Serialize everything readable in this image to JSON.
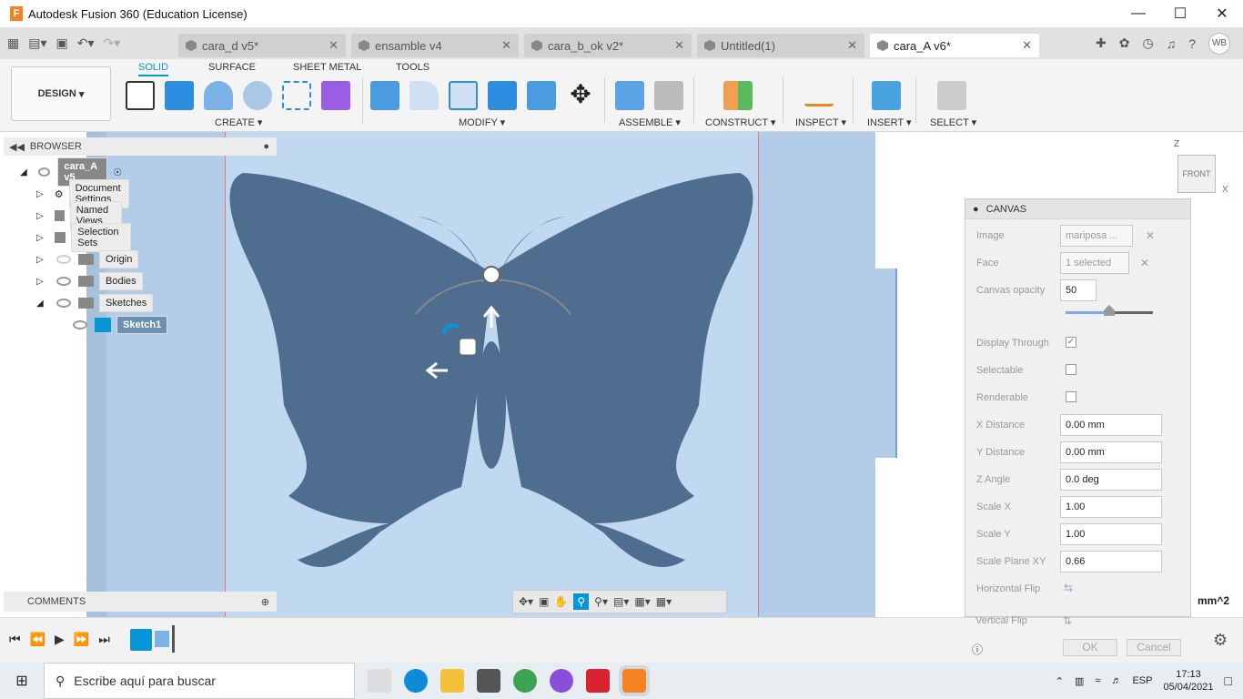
{
  "window": {
    "title": "Autodesk Fusion 360 (Education License)",
    "logo_letter": "F"
  },
  "tabs": [
    {
      "label": "cara_d v5*"
    },
    {
      "label": "ensamble v4"
    },
    {
      "label": "cara_b_ok v2*"
    },
    {
      "label": "Untitled(1)"
    },
    {
      "label": "cara_A v6*"
    }
  ],
  "user": {
    "initials": "WB"
  },
  "toolbar": {
    "design_label": "DESIGN",
    "workspace_tabs": [
      "SOLID",
      "SURFACE",
      "SHEET METAL",
      "TOOLS"
    ],
    "groups": [
      "CREATE",
      "MODIFY",
      "ASSEMBLE",
      "CONSTRUCT",
      "INSPECT",
      "INSERT",
      "SELECT"
    ]
  },
  "browser": {
    "title": "BROWSER",
    "root": "cara_A v5",
    "items": [
      "Document Settings",
      "Named Views",
      "Selection Sets",
      "Origin",
      "Bodies",
      "Sketches",
      "Sketch1"
    ]
  },
  "comments": {
    "title": "COMMENTS"
  },
  "viewcube": {
    "label": "FRONT",
    "z": "Z",
    "x": "X"
  },
  "area_readout": "mm^2",
  "canvas_panel": {
    "title": "CANVAS",
    "image_label": "Image",
    "image_value": "mariposa ...",
    "face_label": "Face",
    "face_value": "1 selected",
    "opacity_label": "Canvas opacity",
    "opacity_value": "50",
    "opacity_level": 0.5,
    "display_through": "Display Through",
    "selectable": "Selectable",
    "renderable": "Renderable",
    "x_distance_label": "X Distance",
    "x_distance": "0.00 mm",
    "y_distance_label": "Y Distance",
    "y_distance": "0.00 mm",
    "z_angle_label": "Z Angle",
    "z_angle": "0.0 deg",
    "scale_x_label": "Scale X",
    "scale_x": "1.00",
    "scale_y_label": "Scale Y",
    "scale_y": "1.00",
    "scale_plane_label": "Scale Plane XY",
    "scale_plane": "0.66",
    "hflip": "Horizontal Flip",
    "vflip": "Vertical Flip",
    "ok": "OK",
    "cancel": "Cancel"
  },
  "taskbar": {
    "search_placeholder": "Escribe aquí para buscar",
    "lang": "ESP",
    "time": "17:13",
    "date": "05/04/2021"
  },
  "colors": {
    "accent": "#0696d7",
    "canvas_fill": "#b3cde8",
    "butterfly": "#4f6e8f"
  }
}
